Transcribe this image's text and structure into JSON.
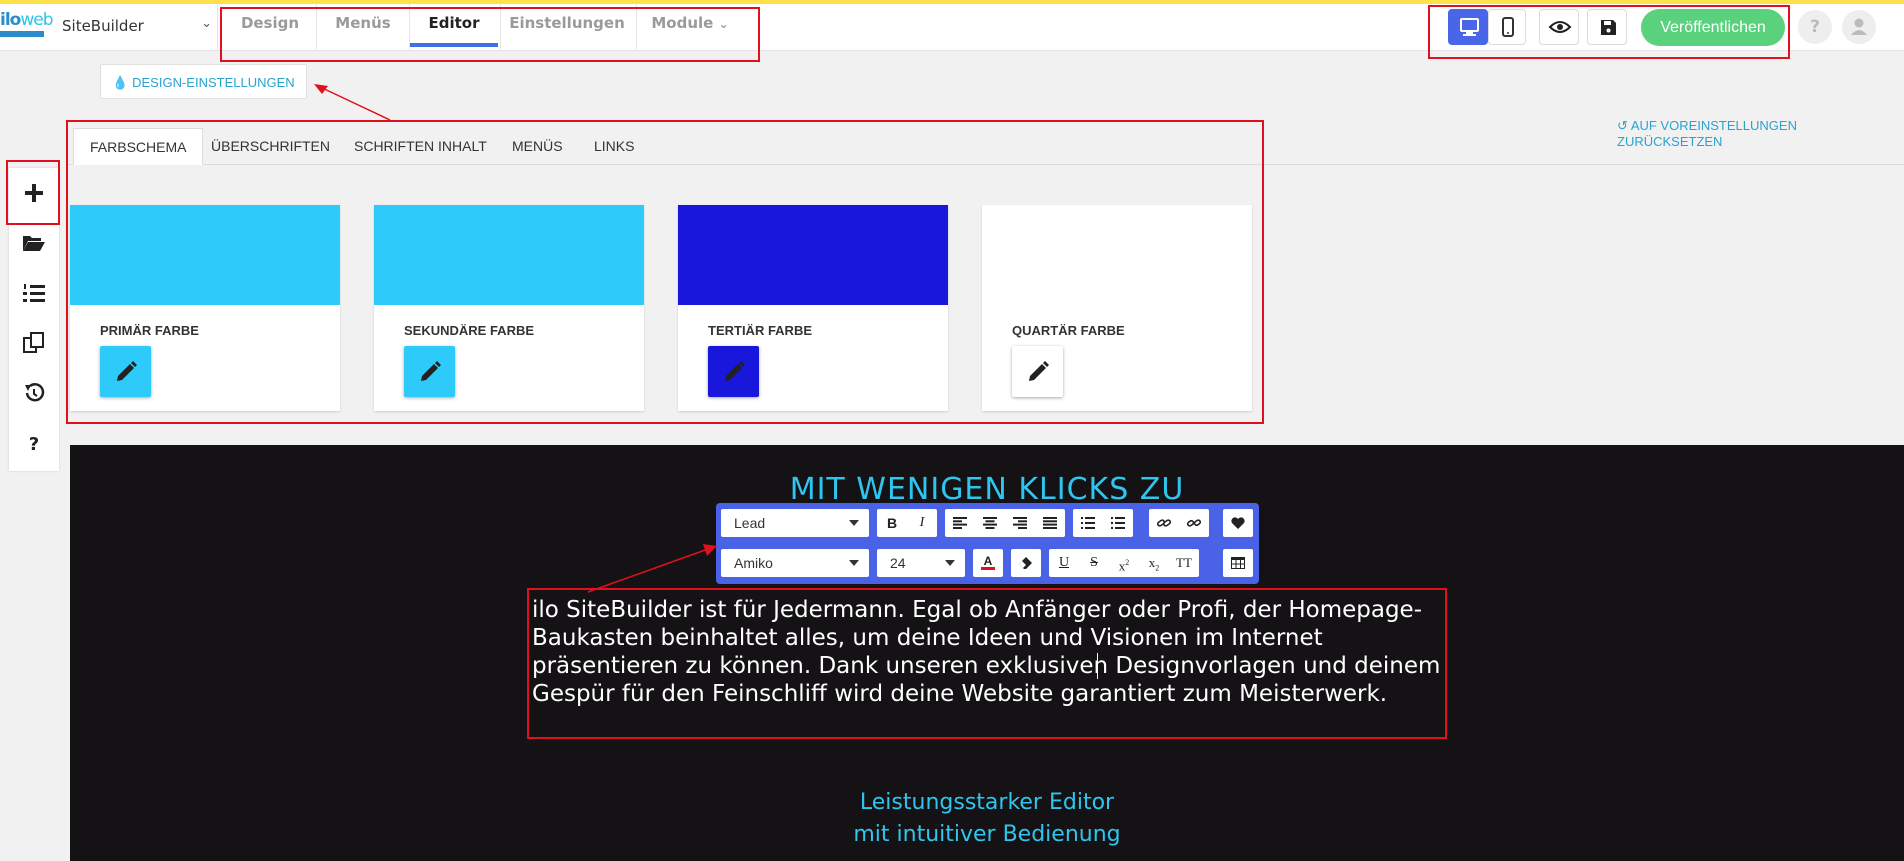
{
  "header": {
    "site_name": "SiteBuilder",
    "logo_text_1": "ilo",
    "logo_text_2": "web",
    "nav_tabs": [
      {
        "label": "Design",
        "active": false
      },
      {
        "label": "Menüs",
        "active": false
      },
      {
        "label": "Editor",
        "active": true
      },
      {
        "label": "Einstellungen",
        "active": false
      },
      {
        "label": "Module",
        "active": false,
        "has_dropdown": true
      }
    ],
    "publish_label": "Veröffentlichen",
    "help_label": "?"
  },
  "design_settings_label": "DESIGN-EINSTELLUNGEN",
  "reset_label": "AUF VOREINSTELLUNGEN ZURÜCKSETZEN",
  "subtabs": [
    {
      "label": "FARBSCHEMA",
      "active": true
    },
    {
      "label": "ÜBERSCHRIFTEN",
      "active": false
    },
    {
      "label": "SCHRIFTEN INHALT",
      "active": false
    },
    {
      "label": "MENÜS",
      "active": false
    },
    {
      "label": "LINKS",
      "active": false
    }
  ],
  "color_cards": [
    {
      "label": "PRIMÄR FARBE",
      "color": "#2ecbfa"
    },
    {
      "label": "SEKUNDÄRE FARBE",
      "color": "#2ecbfa"
    },
    {
      "label": "TERTIÄR FARBE",
      "color": "#1817db"
    },
    {
      "label": "QUARTÄR FARBE",
      "color": "#ffffff"
    }
  ],
  "sidebar_icons": [
    "plus-icon",
    "folder-open-icon",
    "ordered-list-icon",
    "copy-icon",
    "history-icon",
    "question-icon"
  ],
  "toolbar": {
    "style_select": "Lead",
    "font_select": "Amiko",
    "size_select": "24"
  },
  "content": {
    "title": "MIT WENIGEN KLICKS ZU",
    "paragraph": "ilo SiteBuilder ist für Jedermann. Egal ob Anfänger oder Profi, der Homepage-Baukasten beinhaltet alles, um deine Ideen und Visionen im Internet präsentieren zu können. Dank unseren exklusiven Designvorlagen und deinem Gespür für den Feinschliff wird deine Website garantiert zum Meisterwerk.",
    "subtitle_line1": "Leistungsstarker Editor",
    "subtitle_line2": "mit intuitiver Bedienung"
  },
  "colors": {
    "accent_blue": "#4a66e8",
    "publish_green": "#5ad17c",
    "link_cyan": "#2aa3cf",
    "annotation_red": "#e0101c"
  }
}
